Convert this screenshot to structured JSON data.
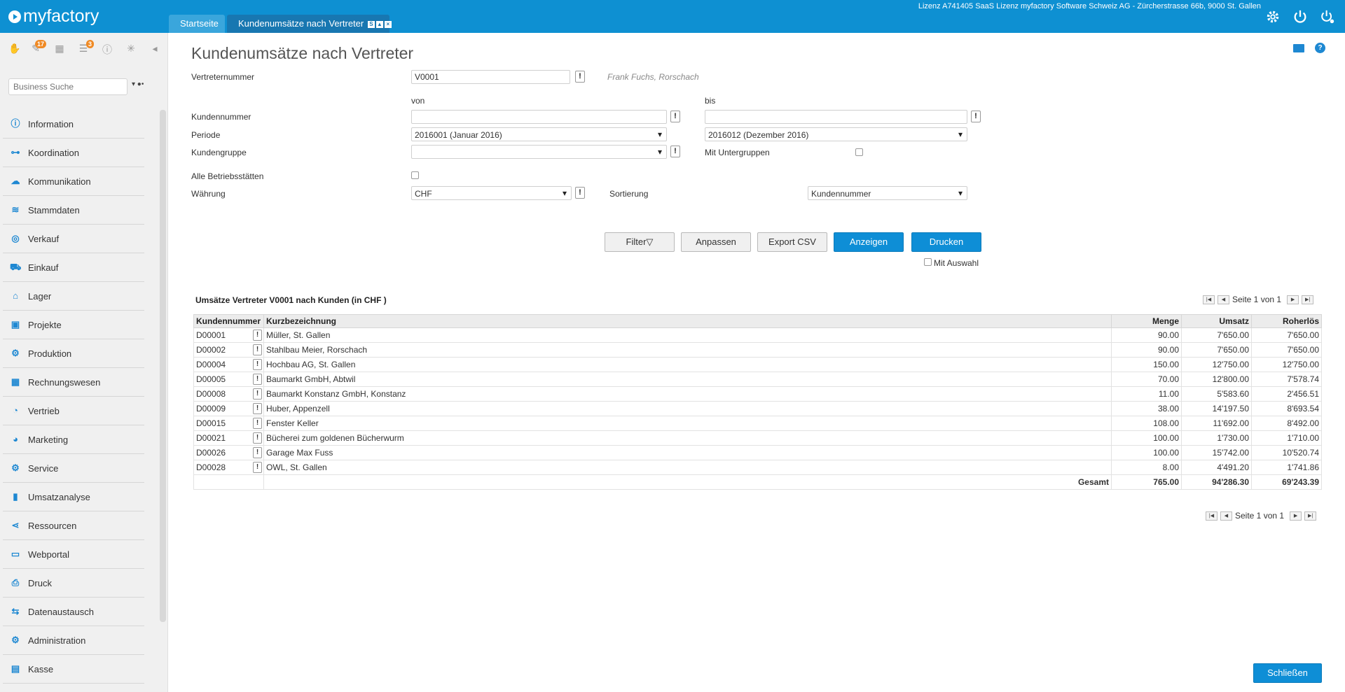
{
  "app": {
    "name": "myfactory"
  },
  "tabs": [
    {
      "label": "Startseite"
    },
    {
      "label": "Kundenumsätze nach Vertreter",
      "mini_s": "S"
    }
  ],
  "license_text": "Lizenz A741405 SaaS Lizenz myfactory Software Schweiz AG - Zürcherstrasse 66b, 9000 St. Gallen",
  "toolbar_badges": {
    "tasks": "17",
    "messages": "3"
  },
  "search": {
    "placeholder": "Business Suche"
  },
  "nav": [
    {
      "label": "Information",
      "icon": "info-icon"
    },
    {
      "label": "Koordination",
      "icon": "coordination-icon"
    },
    {
      "label": "Kommunikation",
      "icon": "chat-icon"
    },
    {
      "label": "Stammdaten",
      "icon": "database-icon"
    },
    {
      "label": "Verkauf",
      "icon": "coins-icon"
    },
    {
      "label": "Einkauf",
      "icon": "cart-icon"
    },
    {
      "label": "Lager",
      "icon": "warehouse-icon"
    },
    {
      "label": "Projekte",
      "icon": "presentation-icon"
    },
    {
      "label": "Produktion",
      "icon": "hand-gear-icon"
    },
    {
      "label": "Rechnungswesen",
      "icon": "grid-icon"
    },
    {
      "label": "Vertrieb",
      "icon": "gauge-icon"
    },
    {
      "label": "Marketing",
      "icon": "pie-icon"
    },
    {
      "label": "Service",
      "icon": "gear-icon"
    },
    {
      "label": "Umsatzanalyse",
      "icon": "bar-chart-icon"
    },
    {
      "label": "Ressourcen",
      "icon": "share-icon"
    },
    {
      "label": "Webportal",
      "icon": "browser-icon"
    },
    {
      "label": "Druck",
      "icon": "printer-icon"
    },
    {
      "label": "Datenaustausch",
      "icon": "sync-icon"
    },
    {
      "label": "Administration",
      "icon": "gear-icon"
    },
    {
      "label": "Kasse",
      "icon": "register-icon"
    }
  ],
  "page": {
    "title": "Kundenumsätze nach Vertreter"
  },
  "form": {
    "vertreternummer_label": "Vertreternummer",
    "vertreternummer_value": "V0001",
    "vertreter_hint": "Frank Fuchs, Rorschach",
    "von_label": "von",
    "bis_label": "bis",
    "kundennummer_label": "Kundennummer",
    "kundennummer_von": "",
    "kundennummer_bis": "",
    "periode_label": "Periode",
    "periode_von": "2016001 (Januar 2016)",
    "periode_bis": "2016012 (Dezember 2016)",
    "kundengruppe_label": "Kundengruppe",
    "kundengruppe_value": "",
    "mit_untergruppen_label": "Mit Untergruppen",
    "alle_betriebsstaetten_label": "Alle Betriebsstätten",
    "waehrung_label": "Währung",
    "waehrung_value": "CHF",
    "sortierung_label": "Sortierung",
    "sortierung_value": "Kundennummer",
    "exclamation": "!"
  },
  "buttons": {
    "filter": "Filter▽",
    "anpassen": "Anpassen",
    "export_csv": "Export CSV",
    "anzeigen": "Anzeigen",
    "drucken": "Drucken",
    "mit_auswahl": "Mit Auswahl",
    "schliessen": "Schließen"
  },
  "table": {
    "title": "Umsätze Vertreter V0001 nach Kunden (in CHF )",
    "pager_text": "Seite 1 von 1",
    "columns": [
      "Kundennummer",
      "Kurzbezeichnung",
      "Menge",
      "Umsatz",
      "Roherlös"
    ],
    "rows": [
      [
        "D00001",
        "Müller, St. Gallen",
        "90.00",
        "7'650.00",
        "7'650.00"
      ],
      [
        "D00002",
        "Stahlbau Meier, Rorschach",
        "90.00",
        "7'650.00",
        "7'650.00"
      ],
      [
        "D00004",
        "Hochbau AG, St. Gallen",
        "150.00",
        "12'750.00",
        "12'750.00"
      ],
      [
        "D00005",
        "Baumarkt GmbH, Abtwil",
        "70.00",
        "12'800.00",
        "7'578.74"
      ],
      [
        "D00008",
        "Baumarkt Konstanz GmbH, Konstanz",
        "11.00",
        "5'583.60",
        "2'456.51"
      ],
      [
        "D00009",
        "Huber, Appenzell",
        "38.00",
        "14'197.50",
        "8'693.54"
      ],
      [
        "D00015",
        "Fenster Keller",
        "108.00",
        "11'692.00",
        "8'492.00"
      ],
      [
        "D00021",
        "Bücherei zum goldenen Bücherwurm",
        "100.00",
        "1'730.00",
        "1'710.00"
      ],
      [
        "D00026",
        "Garage Max Fuss",
        "100.00",
        "15'742.00",
        "10'520.74"
      ],
      [
        "D00028",
        "OWL, St. Gallen",
        "8.00",
        "4'491.20",
        "1'741.86"
      ]
    ],
    "total": {
      "label": "Gesamt",
      "menge": "765.00",
      "umsatz": "94'286.30",
      "roherloes": "69'243.39"
    }
  }
}
